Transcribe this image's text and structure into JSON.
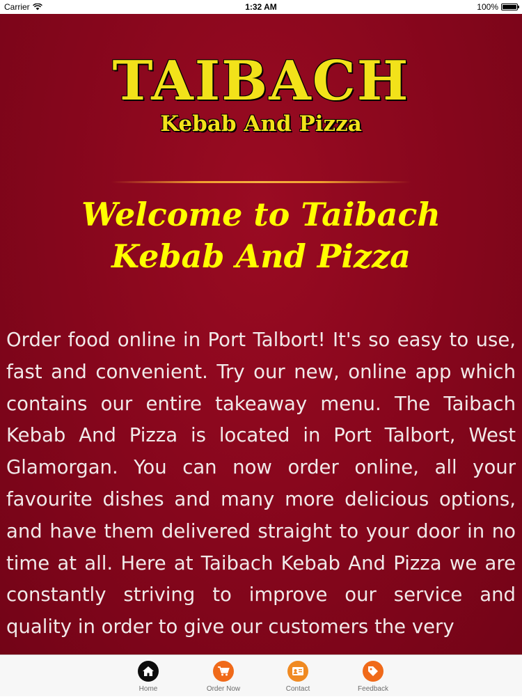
{
  "status_bar": {
    "carrier": "Carrier",
    "time": "1:32 AM",
    "battery": "100%"
  },
  "logo": {
    "main": "TAIBACH",
    "sub": "Kebab And Pizza"
  },
  "welcome": "Welcome to Taibach Kebab And Pizza",
  "body_text": "Order food online in Port Talbort! It's so easy to use, fast and convenient. Try our new, online app which contains our entire takeaway menu. The Taibach Kebab And Pizza is located in Port Talbort, West Glamorgan. You can now order online, all your favourite dishes and many more delicious options, and have them delivered straight to your door in no time at all. Here at Taibach Kebab And Pizza we are constantly striving to improve our service and quality in order to give our customers the very",
  "tabs": [
    {
      "label": "Home",
      "icon": "home-icon",
      "color": "#0d0d0d"
    },
    {
      "label": "Order Now",
      "icon": "cart-icon",
      "color": "#f06a1a"
    },
    {
      "label": "Contact",
      "icon": "contact-card-icon",
      "color": "#f08a22"
    },
    {
      "label": "Feedback",
      "icon": "feedback-tag-icon",
      "color": "#f06a1a"
    }
  ],
  "colors": {
    "background": "#85061c",
    "logo_yellow": "#f2e21a",
    "welcome_yellow": "#ffff00",
    "body_text": "#f1e9e9"
  }
}
